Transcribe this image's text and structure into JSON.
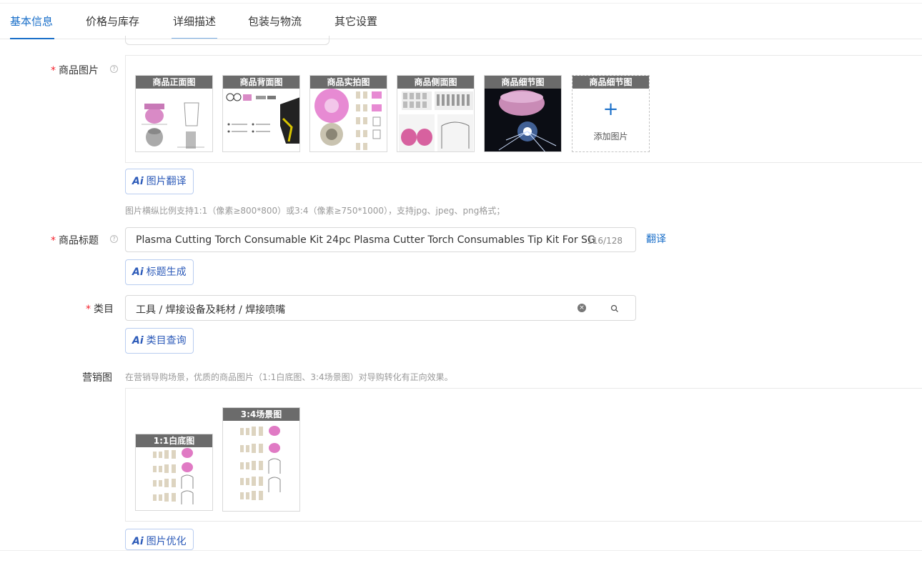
{
  "tabs": [
    {
      "label": "基本信息",
      "active": true
    },
    {
      "label": "价格与库存",
      "active": false
    },
    {
      "label": "详细描述",
      "active": false
    },
    {
      "label": "包装与物流",
      "active": false
    },
    {
      "label": "其它设置",
      "active": false
    }
  ],
  "product_images": {
    "required_mark": "*",
    "label": "商品图片",
    "help_icon": "?",
    "thumbnails": [
      {
        "caption": "商品正面图"
      },
      {
        "caption": "商品背面图"
      },
      {
        "caption": "商品实拍图"
      },
      {
        "caption": "商品侧面图"
      },
      {
        "caption": "商品细节图"
      },
      {
        "caption": "商品细节图",
        "add_icon": "+",
        "add_text": "添加图片"
      }
    ],
    "ai_button": {
      "icon": "Ai",
      "label": "图片翻译"
    },
    "hint": "图片横纵比例支持1:1（像素≥800*800）或3:4（像素≥750*1000），支持jpg、jpeg、png格式；"
  },
  "product_title": {
    "required_mark": "*",
    "label": "商品标题",
    "help_icon": "?",
    "value": "Plasma Cutting Torch Consumable Kit 24pc Plasma Cutter Torch Consumables Tip Kit For SG",
    "counter": "116/128",
    "translate_link": "翻译",
    "ai_button": {
      "icon": "Ai",
      "label": "标题生成"
    }
  },
  "category": {
    "required_mark": "*",
    "label": "类目",
    "value": "工具 / 焊接设备及耗材 / 焊接喷嘴",
    "clear_icon": "×",
    "ai_button": {
      "icon": "Ai",
      "label": "类目查询"
    }
  },
  "marketing_images": {
    "label": "营销图",
    "hint": "在营销导购场景，优质的商品图片（1:1白底图、3:4场景图）对导购转化有正向效果。",
    "thumbnails": [
      {
        "caption": "1:1白底图"
      },
      {
        "caption": "3:4场景图"
      }
    ],
    "ai_button": {
      "icon": "Ai",
      "label": "图片优化"
    }
  }
}
